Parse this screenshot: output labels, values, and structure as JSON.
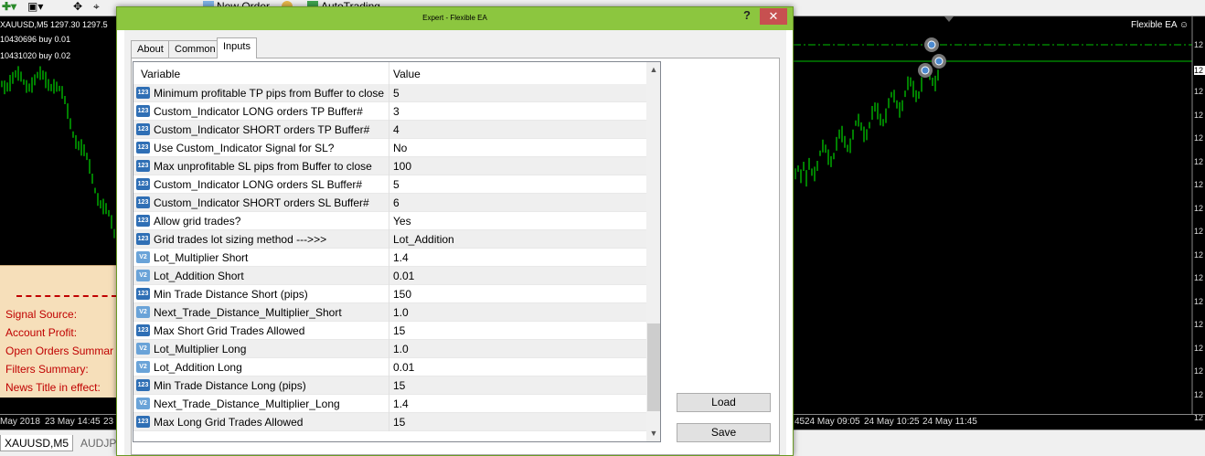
{
  "toolbar": {
    "new_order_label": "New Order",
    "autotrading_label": "AutoTrading"
  },
  "chart": {
    "symbol_info": "XAUUSD,M5  1297.30 1297.5",
    "order_line_1": "10430696 buy 0.01",
    "order_line_2": "10431020 buy 0.02",
    "ea_label": "Flexible EA",
    "price_ticks": [
      "12",
      "12",
      "12",
      "12",
      "12",
      "12",
      "12",
      "12",
      "12",
      "12",
      "12",
      "12",
      "12",
      "12",
      "12",
      "12",
      "12"
    ],
    "time_ticks_left": [
      "May 2018",
      "23 May 14:45",
      "23"
    ],
    "time_ticks_right": [
      "45",
      "24 May 09:05",
      "24 May 10:25",
      "24 May 11:45"
    ],
    "info_panel": {
      "signal_source": "Signal Source:",
      "account_profit": "Account Profit:",
      "open_orders": "Open Orders Summar",
      "filters_summary": "Filters Summary:",
      "news_title": "News Title in effect:"
    },
    "bottom_tabs": [
      "XAUUSD,M5",
      "AUDJPY"
    ],
    "colors": {
      "candle": "#00ff00",
      "background": "#000000",
      "info_text": "#c00000"
    }
  },
  "dialog": {
    "title": "Expert - Flexible EA",
    "help_label": "?",
    "close_label": "✕",
    "tabs": [
      "About",
      "Common",
      "Inputs"
    ],
    "active_tab": "Inputs",
    "columns": {
      "variable": "Variable",
      "value": "Value"
    },
    "rows": [
      {
        "type": "123",
        "variable": "Minimum profitable TP pips from Buffer to close",
        "value": "5"
      },
      {
        "type": "123",
        "variable": "Custom_Indicator LONG orders TP Buffer#",
        "value": "3"
      },
      {
        "type": "123",
        "variable": "Custom_Indicator SHORT orders TP Buffer#",
        "value": "4"
      },
      {
        "type": "123",
        "variable": "Use Custom_Indicator Signal for SL?",
        "value": "No"
      },
      {
        "type": "123",
        "variable": "Max unprofitable SL pips from Buffer to close",
        "value": "100"
      },
      {
        "type": "123",
        "variable": "Custom_Indicator LONG orders SL Buffer#",
        "value": "5"
      },
      {
        "type": "123",
        "variable": "Custom_Indicator SHORT orders SL Buffer#",
        "value": "6"
      },
      {
        "type": "123",
        "variable": "Allow grid trades?",
        "value": "Yes"
      },
      {
        "type": "123",
        "variable": "Grid trades lot sizing method --->>>",
        "value": "Lot_Addition"
      },
      {
        "type": "V2",
        "variable": "Lot_Multiplier Short",
        "value": "1.4"
      },
      {
        "type": "V2",
        "variable": "Lot_Addition Short",
        "value": "0.01"
      },
      {
        "type": "123",
        "variable": "Min Trade Distance Short (pips)",
        "value": "150"
      },
      {
        "type": "V2",
        "variable": "Next_Trade_Distance_Multiplier_Short",
        "value": "1.0"
      },
      {
        "type": "123",
        "variable": "Max Short Grid Trades Allowed",
        "value": "15"
      },
      {
        "type": "V2",
        "variable": "Lot_Multiplier Long",
        "value": "1.0"
      },
      {
        "type": "V2",
        "variable": "Lot_Addition Long",
        "value": "0.01"
      },
      {
        "type": "123",
        "variable": "Min Trade Distance Long (pips)",
        "value": "15"
      },
      {
        "type": "V2",
        "variable": "Next_Trade_Distance_Multiplier_Long",
        "value": "1.4"
      },
      {
        "type": "123",
        "variable": "Max Long Grid Trades Allowed",
        "value": "15"
      }
    ],
    "load_label": "Load",
    "save_label": "Save"
  }
}
